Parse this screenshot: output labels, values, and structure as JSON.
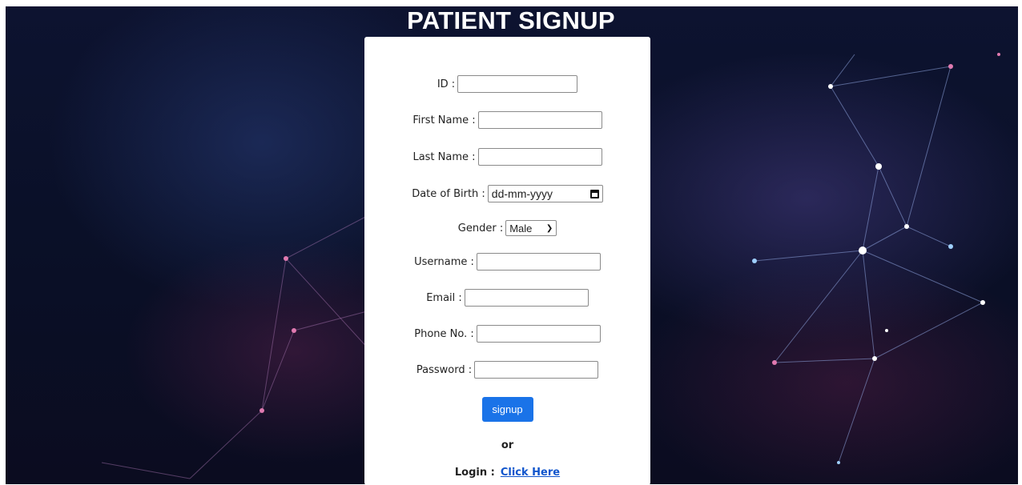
{
  "page": {
    "title": "PATIENT SIGNUP"
  },
  "form": {
    "fields": {
      "id": {
        "label": "ID :",
        "value": ""
      },
      "first_name": {
        "label": "First Name :",
        "value": ""
      },
      "last_name": {
        "label": "Last Name :",
        "value": ""
      },
      "dob": {
        "label": "Date of Birth :",
        "placeholder": "dd-mm-yyyy"
      },
      "gender": {
        "label": "Gender :",
        "selected": "Male",
        "icon": "chevron-down-icon"
      },
      "username": {
        "label": "Username :",
        "value": ""
      },
      "email": {
        "label": "Email :",
        "value": ""
      },
      "phone": {
        "label": "Phone No. :",
        "value": ""
      },
      "password": {
        "label": "Password :",
        "value": ""
      }
    },
    "signup_label": "signup",
    "or_text": "or",
    "login_label": "Login :",
    "login_link": "Click Here"
  },
  "colors": {
    "button": "#1a73e8",
    "link": "#1155cc",
    "card": "#ffffff"
  }
}
